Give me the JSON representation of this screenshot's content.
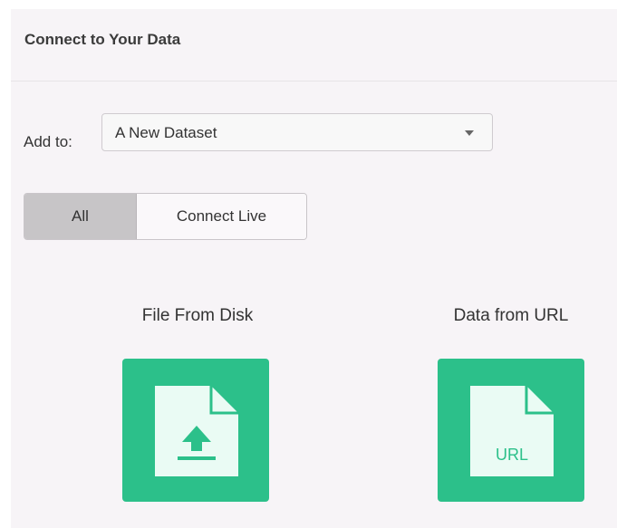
{
  "header": {
    "title": "Connect to Your Data"
  },
  "add_to": {
    "label": "Add to:",
    "selected": "A New Dataset"
  },
  "filter": {
    "all_label": "All",
    "live_label": "Connect Live"
  },
  "sources": [
    {
      "label": "File From Disk",
      "icon": "file-upload-icon"
    },
    {
      "label": "Data from URL",
      "icon": "url-file-icon",
      "icon_text": "URL"
    }
  ],
  "colors": {
    "tile": "#2cc08a",
    "panel_bg": "#f7f4f7"
  }
}
